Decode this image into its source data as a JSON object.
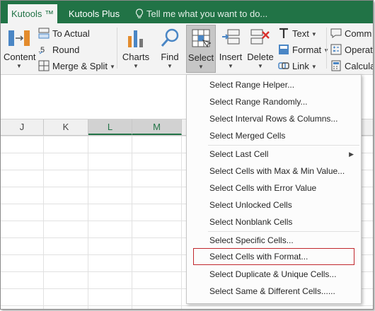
{
  "tabs": {
    "kutools": "Kutools ™",
    "kutools_plus": "Kutools Plus",
    "tell_me": "Tell me what you want to do..."
  },
  "ribbon": {
    "content": "Content",
    "to_actual": "To Actual",
    "round": "Round",
    "merge_split": "Merge & Split",
    "charts": "Charts",
    "find": "Find",
    "select": "Select",
    "insert": "Insert",
    "delete": "Delete",
    "text": "Text",
    "format": "Format",
    "link": "Link",
    "comment": "Comm",
    "operation": "Operat",
    "calculator": "Calcula"
  },
  "columns": [
    "J",
    "K",
    "L",
    "M"
  ],
  "highlighted_columns": [
    "L",
    "M"
  ],
  "menu": {
    "items": [
      "Select Range Helper...",
      "Select Range Randomly...",
      "Select Interval Rows & Columns...",
      "Select Merged Cells",
      "Select Last Cell",
      "Select Cells with Max & Min Value...",
      "Select Cells with Error Value",
      "Select Unlocked Cells",
      "Select Nonblank Cells",
      "Select Specific Cells...",
      "Select Cells with Format...",
      "Select Duplicate & Unique Cells...",
      "Select Same & Different Cells......"
    ],
    "highlighted_item": "Select Cells with Format..."
  },
  "colors": {
    "accent": "#217346",
    "highlight_border": "#c1272d"
  }
}
